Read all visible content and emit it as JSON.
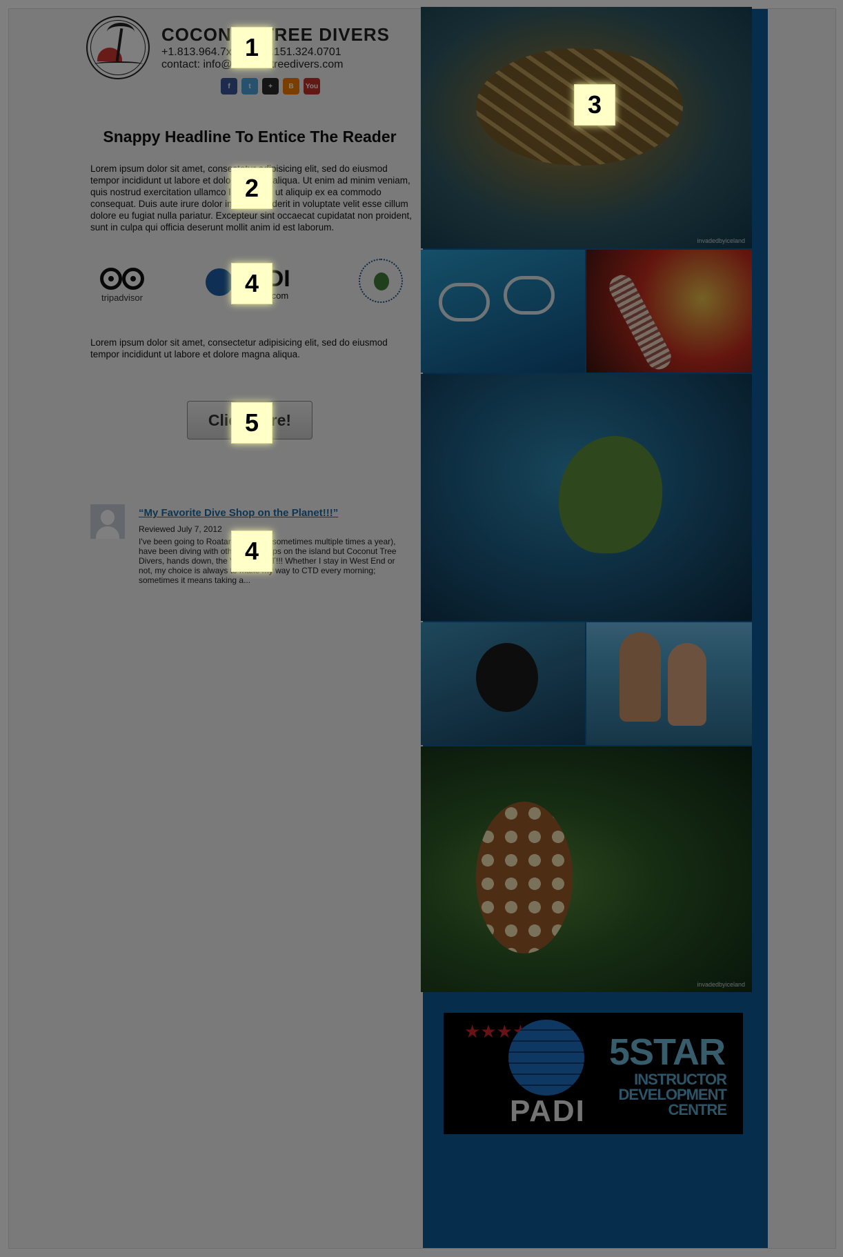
{
  "header": {
    "brand": "COCONUT TREE DIVERS",
    "phone": "+1.813.964.7xxx / +44.151.324.0701",
    "contact": "contact: info@coconuttreedivers.com",
    "social": [
      {
        "icon": "facebook-icon",
        "label": "f"
      },
      {
        "icon": "twitter-icon",
        "label": "t"
      },
      {
        "icon": "google-plus-icon",
        "label": "+"
      },
      {
        "icon": "blogger-icon",
        "label": "B"
      },
      {
        "icon": "youtube-icon",
        "label": "You"
      }
    ]
  },
  "content": {
    "headline": "Snappy Headline To Entice The Reader",
    "paragraph1": "Lorem ipsum dolor sit amet, consectetur adipisicing elit, sed do eiusmod tempor incididunt ut labore et dolore magna aliqua. Ut enim ad minim veniam, quis nostrud exercitation ullamco laboris nisi ut aliquip ex ea commodo consequat. Duis aute irure dolor in reprehenderit in voluptate velit esse cillum dolore eu fugiat nulla pariatur. Excepteur sint occaecat cupidatat non proident, sunt in culpa qui officia deserunt mollit anim id est laborum.",
    "paragraph2": "Lorem ipsum dolor sit amet, consectetur adipisicing elit, sed do eiusmod tempor incididunt ut labore et dolore magna aliqua.",
    "cta_label": "Click Here!"
  },
  "partners": {
    "tripadvisor": "tripadvisor",
    "padi": "PADI",
    "padi_domain": ".com"
  },
  "review": {
    "title": "“My Favorite Dive Shop on the Planet!!!”",
    "date": "Reviewed July 7, 2012",
    "text": "I've been going to Roatan for years (sometimes multiple times a year), have been diving with other dive shops on the island but Coconut Tree Divers, hands down, the VERY BEST!!! Whether I stay in West End or not, my choice is always to make my way to CTD every morning; sometimes it means taking a..."
  },
  "gallery": {
    "watermark": "invadedbyiceland"
  },
  "badge": {
    "stars": "★★★★★",
    "padi": "PADI",
    "five_star": "5STAR",
    "line1": "INSTRUCTOR",
    "line2": "DEVELOPMENT",
    "line3": "CENTRE"
  },
  "markers": [
    "1",
    "2",
    "3",
    "4",
    "4",
    "5"
  ],
  "colors": {
    "sidebar": "#0f5a9a",
    "link": "#1a6ca8",
    "marker": "#ffffc8"
  }
}
